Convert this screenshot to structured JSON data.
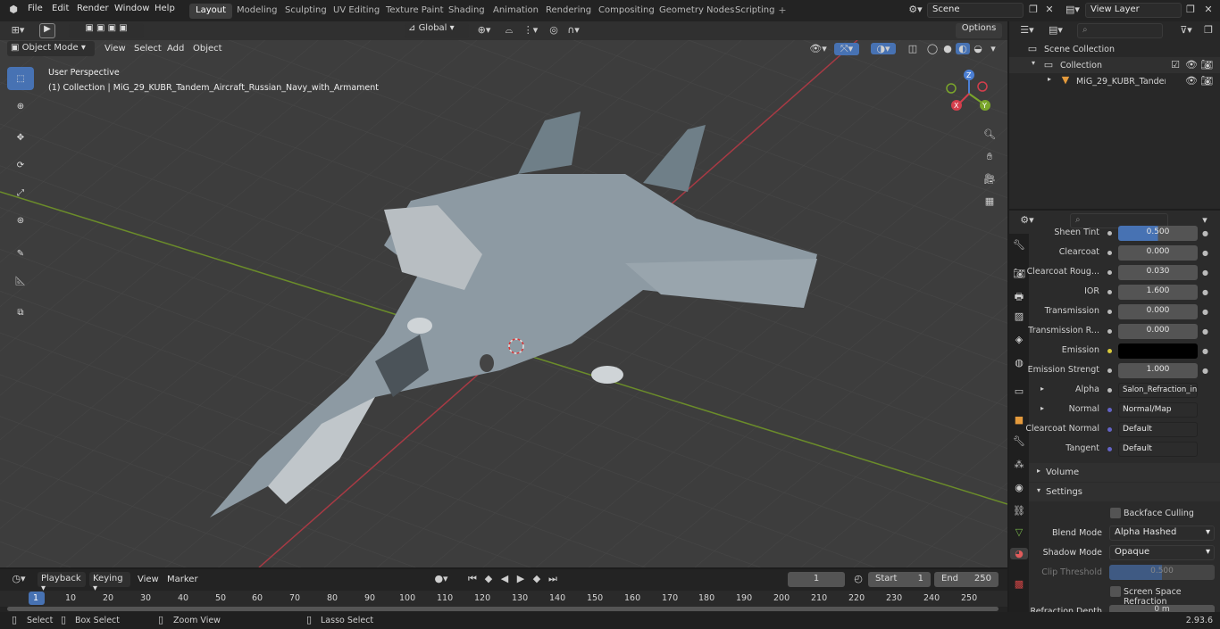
{
  "menus": [
    "File",
    "Edit",
    "Render",
    "Window",
    "Help"
  ],
  "workspaces": [
    "Layout",
    "Modeling",
    "Sculpting",
    "UV Editing",
    "Texture Paint",
    "Shading",
    "Animation",
    "Rendering",
    "Compositing",
    "Geometry Nodes",
    "Scripting"
  ],
  "active_workspace": "Layout",
  "scene_name": "Scene",
  "view_layer": "View Layer",
  "viewport": {
    "mode": "Object Mode",
    "menus": [
      "View",
      "Select",
      "Add",
      "Object"
    ],
    "transform_orientation": "Global",
    "options_label": "Options",
    "info_line1": "User Perspective",
    "info_line2": "(1) Collection | MiG_29_KUBR_Tandem_Aircraft_Russian_Navy_with_Armament",
    "gizmo": {
      "z": "Z",
      "y": "Y",
      "x": "X"
    }
  },
  "outliner": {
    "scene_collection": "Scene Collection",
    "collection": "Collection",
    "object": "MiG_29_KUBR_Tandem_A"
  },
  "properties": {
    "rows": [
      {
        "label": "Sheen Tint",
        "value": "0.500",
        "fill": 0.5
      },
      {
        "label": "Clearcoat",
        "value": "0.000"
      },
      {
        "label": "Clearcoat Roug...",
        "value": "0.030"
      },
      {
        "label": "IOR",
        "value": "1.600"
      },
      {
        "label": "Transmission",
        "value": "0.000"
      },
      {
        "label": "Transmission R...",
        "value": "0.000"
      },
      {
        "label": "Emission",
        "value": ""
      },
      {
        "label": "Emission Strengt",
        "value": "1.000"
      },
      {
        "label": "Alpha",
        "value": "Salon_Refraction_in..."
      },
      {
        "label": "Normal",
        "value": "Normal/Map"
      },
      {
        "label": "Clearcoat Normal",
        "value": "Default"
      },
      {
        "label": "Tangent",
        "value": "Default"
      }
    ],
    "volume_label": "Volume",
    "settings_label": "Settings",
    "backface_culling": "Backface Culling",
    "blend_mode_label": "Blend Mode",
    "blend_mode_value": "Alpha Hashed",
    "shadow_mode_label": "Shadow Mode",
    "shadow_mode_value": "Opaque",
    "clip_threshold_label": "Clip Threshold",
    "clip_threshold_value": "0.500",
    "screen_space_refraction": "Screen Space Refraction",
    "refraction_depth_label": "Refraction Depth",
    "refraction_depth_value": "0 m"
  },
  "timeline": {
    "menus": [
      "Playback",
      "Keying",
      "View",
      "Marker"
    ],
    "current_frame": "1",
    "start_label": "Start",
    "start_value": "1",
    "end_label": "End",
    "end_value": "250",
    "ticks": [
      "1",
      "10",
      "20",
      "30",
      "40",
      "50",
      "60",
      "70",
      "80",
      "90",
      "100",
      "110",
      "120",
      "130",
      "140",
      "150",
      "160",
      "170",
      "180",
      "190",
      "200",
      "210",
      "220",
      "230",
      "240",
      "250"
    ]
  },
  "status": {
    "select": "Select",
    "box_select": "Box Select",
    "zoom_view": "Zoom View",
    "lasso_select": "Lasso Select",
    "version": "2.93.6"
  }
}
